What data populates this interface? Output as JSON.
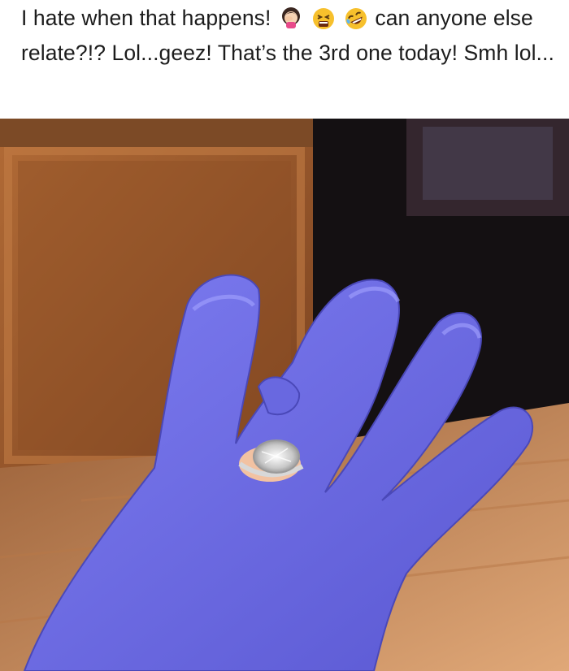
{
  "post": {
    "caption_part1": "I hate when that happens!",
    "caption_part2": "can anyone else relate?!? Lol...geez! That’s the 3rd one today! Smh lol...",
    "emojis": [
      "woman-facepalming-icon",
      "tired-face-icon",
      "rolling-on-floor-laughing-icon"
    ]
  },
  "photo": {
    "subject": "purple nitrile glove with diamond ring poking through a hole",
    "colors": {
      "glove": "#6f6ee6",
      "cabinet": "#9a5a2c",
      "floor": "#c98a5a",
      "dark": "#141012"
    }
  }
}
